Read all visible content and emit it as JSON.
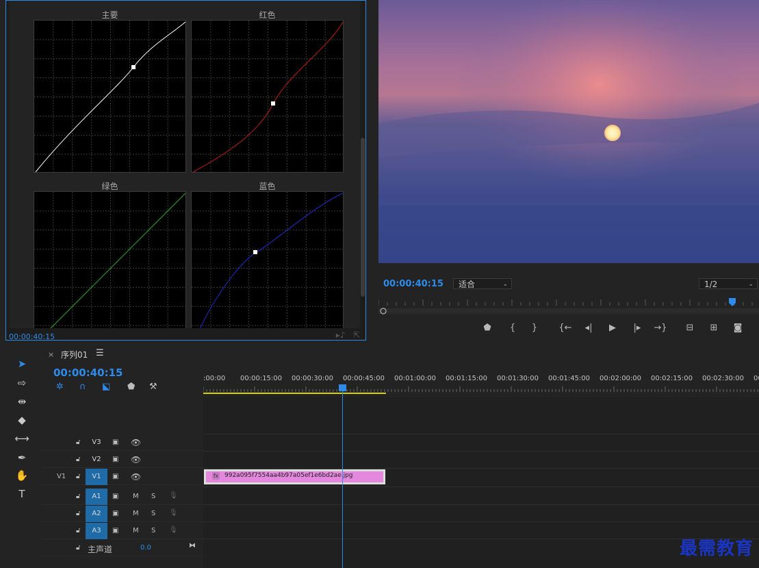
{
  "effect_controls": {
    "curves": [
      {
        "label": "主要",
        "color": "#ffffff"
      },
      {
        "label": "红色",
        "color": "#c81414"
      },
      {
        "label": "绿色",
        "color": "#19b419"
      },
      {
        "label": "蓝色",
        "color": "#1a2bd8"
      }
    ],
    "timecode": "00:00:40:15"
  },
  "program_monitor": {
    "timecode": "00:00:40:15",
    "fit_select": "适合",
    "resolution_select": "1/2",
    "controls": [
      "add-marker",
      "mark-in",
      "mark-out",
      "go-to-in",
      "step-back",
      "play",
      "step-forward",
      "go-to-out",
      "lift",
      "extract",
      "export-frame"
    ]
  },
  "tools": [
    "selection",
    "track-select",
    "ripple-edit",
    "razor",
    "slip",
    "pen",
    "hand",
    "type"
  ],
  "timeline": {
    "sequence_name": "序列01",
    "timecode": "00:00:40:15",
    "ruler_labels": [
      ":00:00",
      "00:00:15:00",
      "00:00:30:00",
      "00:00:45:00",
      "00:01:00:00",
      "00:01:15:00",
      "00:01:30:00",
      "00:01:45:00",
      "00:02:00:00",
      "00:02:15:00",
      "00:02:30:00",
      "00"
    ],
    "tracks": [
      {
        "source": "",
        "name": "V3",
        "type": "video"
      },
      {
        "source": "",
        "name": "V2",
        "type": "video"
      },
      {
        "source": "V1",
        "name": "V1",
        "type": "video"
      },
      {
        "source": "",
        "name": "A1",
        "type": "audio"
      },
      {
        "source": "",
        "name": "A2",
        "type": "audio"
      },
      {
        "source": "",
        "name": "A3",
        "type": "audio"
      }
    ],
    "master_label": "主声道",
    "master_value": "0.0",
    "mute_label": "M",
    "solo_label": "S",
    "clip": {
      "fx": "fx",
      "name": "992a095f7554aa4b97a05ef1e6bd2ae.jpg"
    }
  },
  "watermark": "最需教育"
}
